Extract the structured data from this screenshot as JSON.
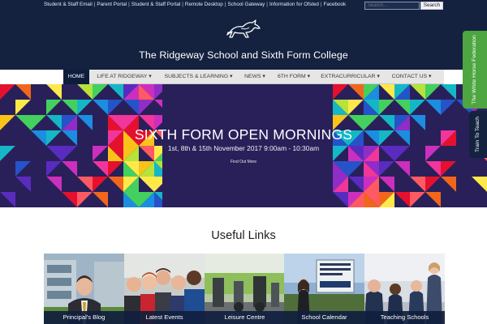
{
  "top_links": [
    "Student & Staff Email",
    "Parent Portal",
    "Student & Staff Portal",
    "Remote Desktop",
    "School Gateway",
    "Information for Ofsted",
    "Facebook"
  ],
  "top_link_separator": "|",
  "search": {
    "placeholder": "Search...",
    "button_label": "Search"
  },
  "logo": {
    "icon": "white-horse-logo"
  },
  "site_title": "The Ridgeway School and Sixth Form College",
  "nav": [
    {
      "label": "HOME",
      "active": true
    },
    {
      "label": "LIFE AT RIDGEWAY ▾",
      "active": false
    },
    {
      "label": "SUBJECTS & LEARNING ▾",
      "active": false
    },
    {
      "label": "NEWS ▾",
      "active": false
    },
    {
      "label": "6TH FORM ▾",
      "active": false
    },
    {
      "label": "EXTRACURRICULAR ▾",
      "active": false
    },
    {
      "label": "CONTACT US ▾",
      "active": false
    }
  ],
  "banner": {
    "title": "SIXTH FORM OPEN MORNINGS",
    "subtitle": "1st, 8th & 15th November 2017 9:00am - 10:30am",
    "link": "Find Out More"
  },
  "side_tabs": [
    {
      "label": "The White Horse Federation",
      "color": "#4da641"
    },
    {
      "label": "Train To Teach",
      "color": "#14223f"
    }
  ],
  "useful_links": {
    "title": "Useful Links",
    "cards": [
      {
        "label": "Principal's Blog",
        "image": "principal-portrait"
      },
      {
        "label": "Latest Events",
        "image": "students-group"
      },
      {
        "label": "Leisure Centre",
        "image": "gym-equipment"
      },
      {
        "label": "School Calendar",
        "image": "school-sign"
      },
      {
        "label": "Teaching Schools",
        "image": "classroom-students"
      }
    ]
  },
  "colors": {
    "header_bg": "#14223f",
    "nav_bg": "#e6e6e6",
    "nav_active": "#0f1d3d",
    "banner_bg": "#29205a",
    "caption_bg": "#101e3e"
  }
}
